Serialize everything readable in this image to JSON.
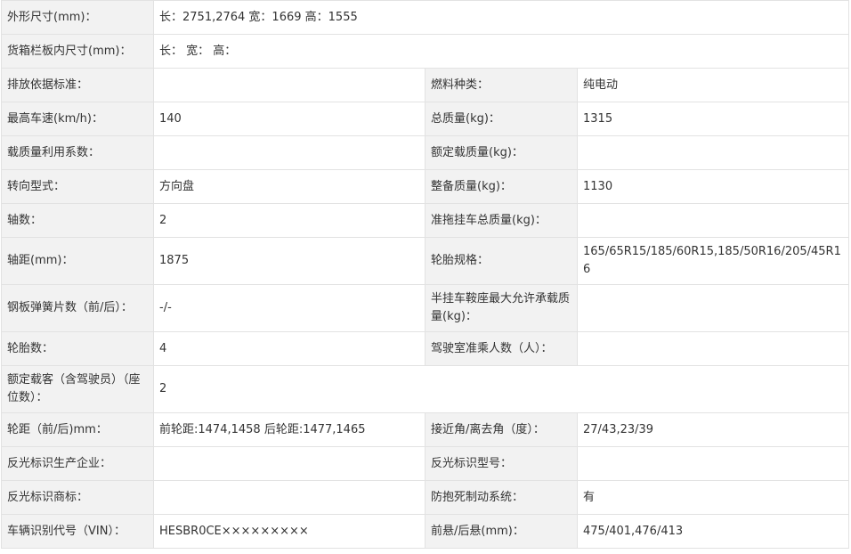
{
  "rows": [
    {
      "l1": "外形尺寸(mm)：",
      "v1": "长：2751,2764 宽：1669 高：1555",
      "full": true
    },
    {
      "l1": "货箱栏板内尺寸(mm)：",
      "v1": "长： 宽： 高：",
      "full": true
    },
    {
      "l1": "排放依据标准：",
      "v1": "",
      "l2": "燃料种类：",
      "v2": "纯电动"
    },
    {
      "l1": "最高车速(km/h)：",
      "v1": "140",
      "l2": "总质量(kg)：",
      "v2": "1315"
    },
    {
      "l1": "载质量利用系数：",
      "v1": "",
      "l2": "额定载质量(kg)：",
      "v2": ""
    },
    {
      "l1": "转向型式：",
      "v1": "方向盘",
      "l2": "整备质量(kg)：",
      "v2": "1130"
    },
    {
      "l1": "轴数：",
      "v1": "2",
      "l2": "准拖挂车总质量(kg)：",
      "v2": ""
    },
    {
      "l1": "轴距(mm)：",
      "v1": "1875",
      "l2": "轮胎规格：",
      "v2": "165/65R15/185/60R15,185/50R16/205/45R16"
    },
    {
      "l1": "钢板弹簧片数（前/后）：",
      "v1": "-/-",
      "l2": "半挂车鞍座最大允许承载质量(kg)：",
      "v2": ""
    },
    {
      "l1": "轮胎数：",
      "v1": "4",
      "l2": "驾驶室准乘人数（人）：",
      "v2": ""
    },
    {
      "l1": "额定载客（含驾驶员）（座位数）：",
      "v1": "2",
      "full": true
    },
    {
      "l1": "轮距（前/后)mm：",
      "v1": "前轮距:1474,1458 后轮距:1477,1465",
      "l2": "接近角/离去角（度）：",
      "v2": "27/43,23/39"
    },
    {
      "l1": "反光标识生产企业：",
      "v1": "",
      "l2": "反光标识型号：",
      "v2": ""
    },
    {
      "l1": "反光标识商标：",
      "v1": "",
      "l2": "防抱死制动系统：",
      "v2": "有"
    },
    {
      "l1": "车辆识别代号（VIN）：",
      "v1": "HESBR0CE×××××××××",
      "l2": "前悬/后悬(mm)：",
      "v2": "475/401,476/413"
    }
  ]
}
